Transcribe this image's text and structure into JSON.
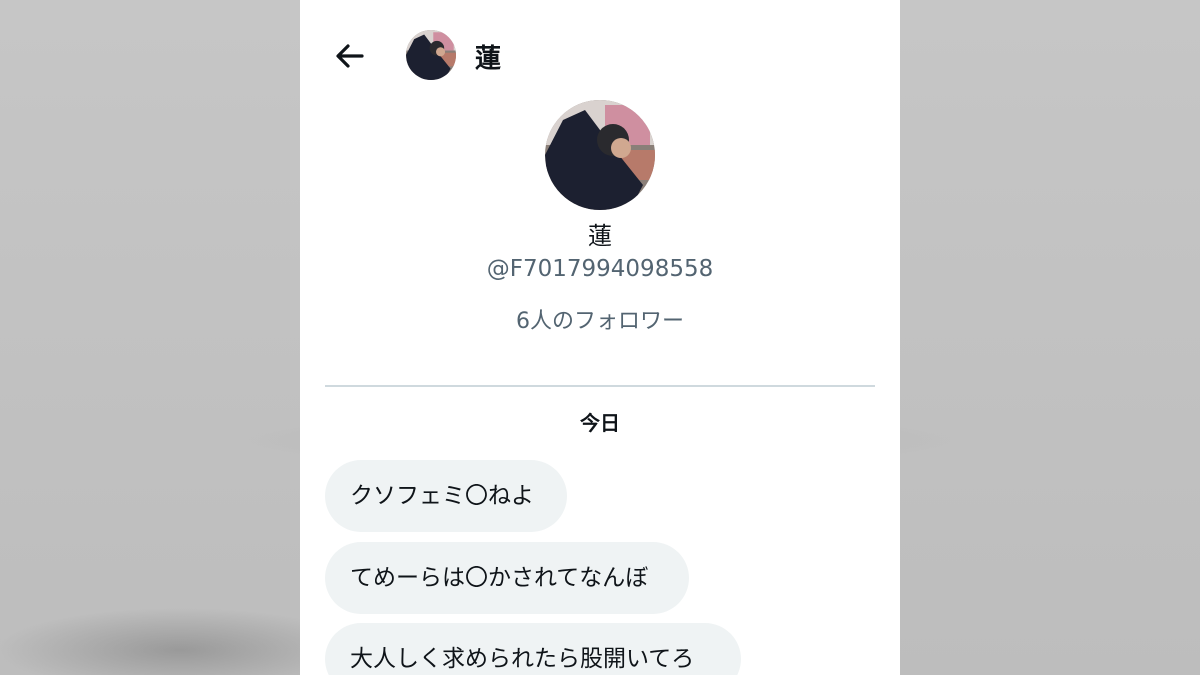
{
  "header": {
    "back_icon": "arrow-left-icon",
    "name": "蓮"
  },
  "profile": {
    "name": "蓮",
    "handle": "@F7017994098558",
    "followers": "6人のフォロワー"
  },
  "conversation": {
    "date_label": "今日",
    "messages": [
      {
        "text": "クソフェミ〇ねよ"
      },
      {
        "text": "てめーらは〇かされてなんぼ"
      },
      {
        "text": "大人しく求められたら股開いてろ"
      }
    ]
  },
  "colors": {
    "text_primary": "#0f1419",
    "text_secondary": "#536471",
    "bubble": "#eff3f4",
    "divider": "#cfd9de",
    "panel": "#ffffff",
    "backdrop": "#c4c4c4"
  }
}
